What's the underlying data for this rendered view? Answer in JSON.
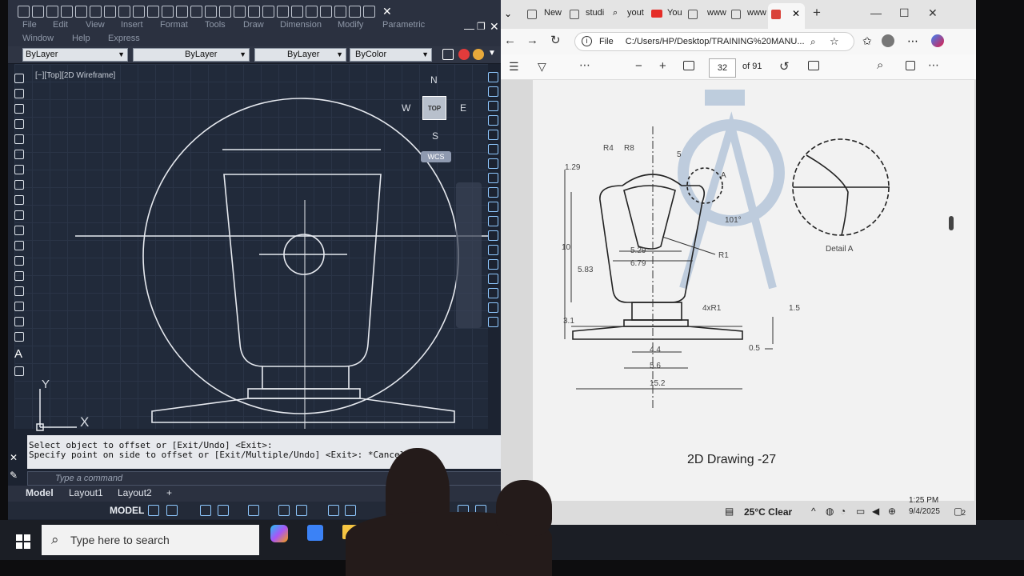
{
  "autocad": {
    "menus": [
      "File",
      "Edit",
      "View",
      "Insert",
      "Format",
      "Tools",
      "Draw",
      "Dimension",
      "Modify",
      "Parametric",
      "Window",
      "Help",
      "Express"
    ],
    "props": {
      "layer": "ByLayer",
      "linetype": "ByLayer",
      "lineweight": "ByLayer",
      "color": "ByColor"
    },
    "viewport_label": "[−][Top][2D Wireframe]",
    "viewcube": {
      "top": "TOP",
      "n": "N",
      "s": "S",
      "e": "E",
      "w": "W",
      "wcs": "WCS"
    },
    "ucs": {
      "x": "X",
      "y": "Y"
    },
    "command_history": [
      "Select object to offset or [Exit/Undo] <Exit>:",
      "Specify point on side to offset or [Exit/Multiple/Undo] <Exit>: *Cancel*"
    ],
    "command_placeholder": "Type a command",
    "layout_tabs": [
      "Model",
      "Layout1",
      "Layout2"
    ],
    "add_tab": "+",
    "status_model": "MODEL"
  },
  "browser": {
    "tabs": [
      "New",
      "studi",
      "yout",
      "You",
      "www",
      "www"
    ],
    "url_prefix": "File",
    "url": "C:/Users/HP/Desktop/TRAINING%20MANU...",
    "zoom_minus": "−",
    "zoom_plus": "+",
    "page_number": "32",
    "page_total": "of 91",
    "drawing": {
      "radius_labels": [
        "R4",
        "R8",
        "R1",
        "4xR1"
      ],
      "dims": [
        "1.29",
        "5",
        "101°",
        "10",
        "5.83",
        "5.29",
        "6.79",
        "3.1",
        "1.5",
        "0.5",
        "4.4",
        "5.6",
        "15.2"
      ],
      "detail_letter": "A",
      "detail_label": "Detail A",
      "caption": "2D Drawing -27"
    }
  },
  "taskbar": {
    "search_placeholder": "Type here to search",
    "weather": "25°C Clear",
    "time": "1:25 PM",
    "date": "9/4/2025",
    "notification_count": "2"
  },
  "colors": {
    "acad_bg": "#212a3a",
    "accent_blue": "#8ec8ff",
    "pdf_bg": "#f2f2f2"
  }
}
